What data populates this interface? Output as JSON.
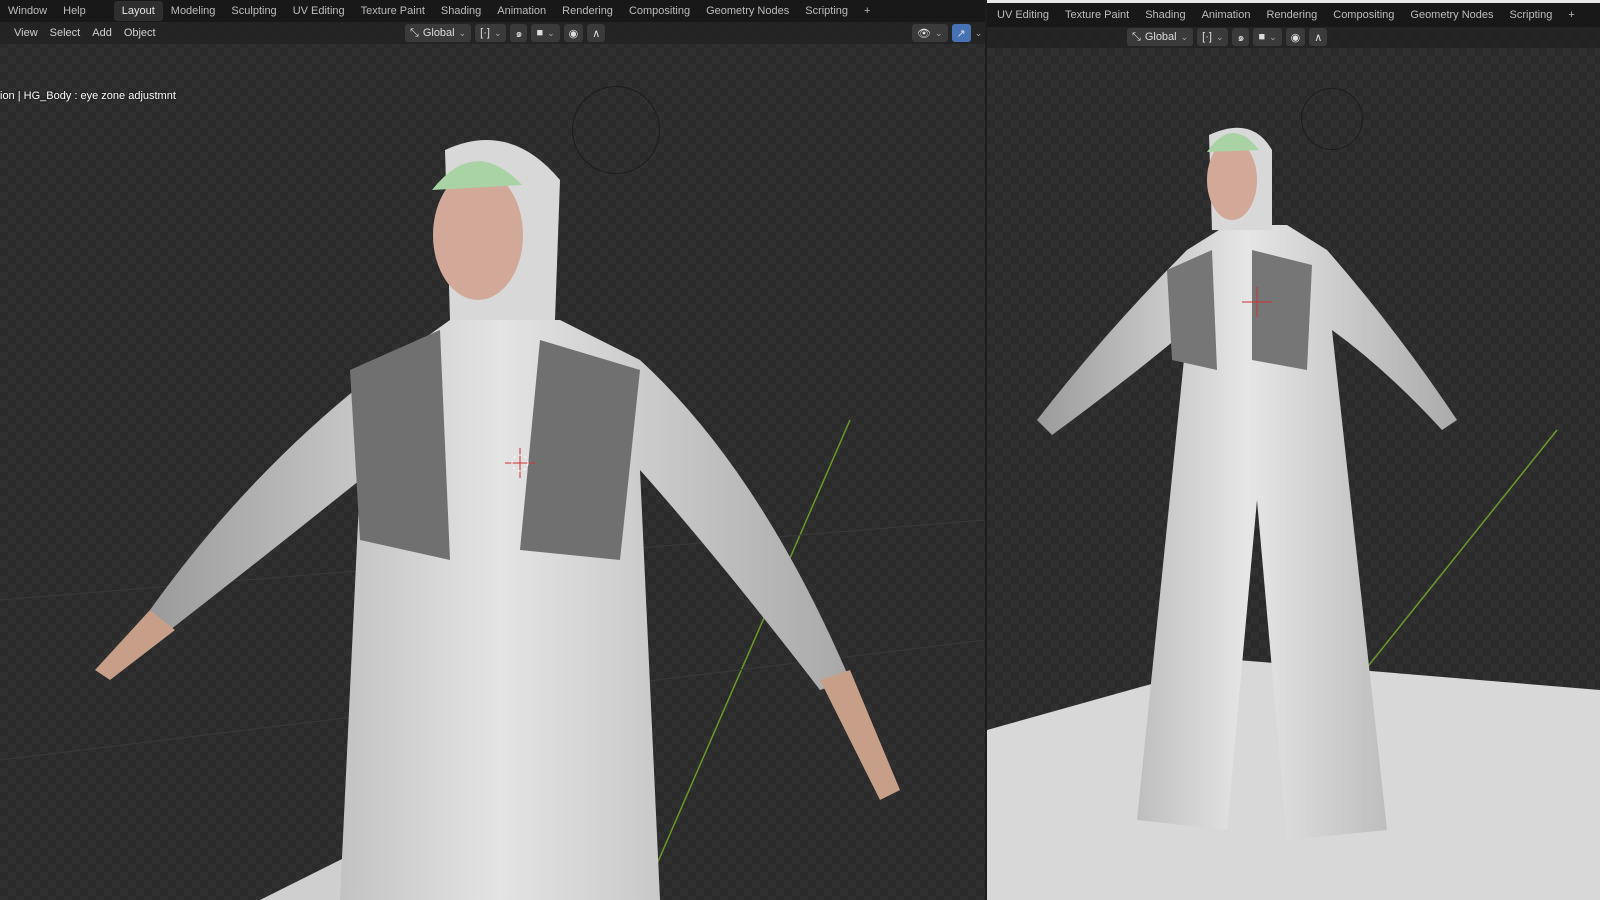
{
  "left": {
    "menu": [
      "Window",
      "Help"
    ],
    "tabs": [
      "Layout",
      "Modeling",
      "Sculpting",
      "UV Editing",
      "Texture Paint",
      "Shading",
      "Animation",
      "Rendering",
      "Compositing",
      "Geometry Nodes",
      "Scripting"
    ],
    "active_tab": "Layout",
    "add_tab": "+",
    "header_menu": [
      "View",
      "Select",
      "Add",
      "Object"
    ],
    "orientation": "Global",
    "status_text": "ion | HG_Body : eye zone adjustmnt"
  },
  "right": {
    "tabs": [
      "UV Editing",
      "Texture Paint",
      "Shading",
      "Animation",
      "Rendering",
      "Compositing",
      "Geometry Nodes",
      "Scripting"
    ],
    "add_tab": "+",
    "orientation": "Global"
  },
  "colors": {
    "accent": "#4772b3",
    "grid_y_axis": "#6a9a2a"
  }
}
